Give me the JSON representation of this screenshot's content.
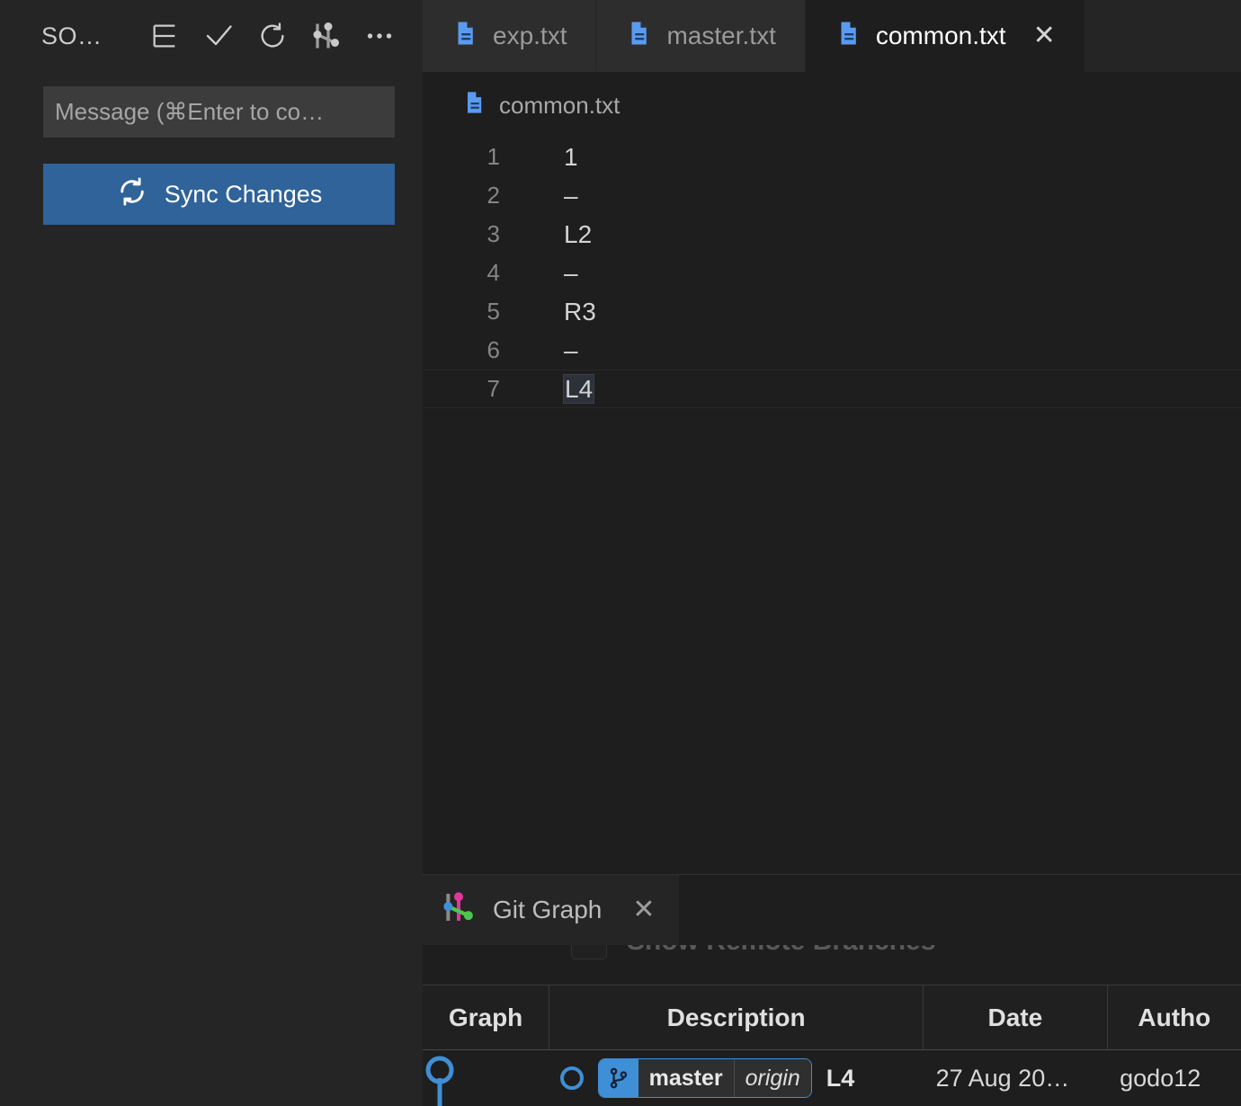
{
  "colors": {
    "accent_blue": "#3f8fd6",
    "button_blue": "#2f6399",
    "editor_bg": "#1e1e1e",
    "sidebar_bg": "#252526",
    "tab_inactive_bg": "#2d2d2d"
  },
  "sidebar": {
    "toolbar": {
      "title": "SO…",
      "buttons": [
        {
          "name": "view-as-tree-icon",
          "label": "View as Tree"
        },
        {
          "name": "commit-check-icon",
          "label": "Commit"
        },
        {
          "name": "refresh-icon",
          "label": "Refresh"
        },
        {
          "name": "git-graph-icon",
          "label": "View Git Graph"
        },
        {
          "name": "more-actions-icon",
          "label": "…"
        }
      ]
    },
    "commit_input": {
      "placeholder": "Message (⌘Enter to co…",
      "value": ""
    },
    "sync_button": {
      "label": "Sync Changes",
      "icon": "sync-icon"
    }
  },
  "editor": {
    "tabs": [
      {
        "label": "exp.txt",
        "icon": "text-file-icon",
        "active": false,
        "closable": false
      },
      {
        "label": "master.txt",
        "icon": "text-file-icon",
        "active": false,
        "closable": false
      },
      {
        "label": "common.txt",
        "icon": "text-file-icon",
        "active": true,
        "closable": true,
        "close_glyph": "✕"
      }
    ],
    "breadcrumb": {
      "icon": "text-file-icon",
      "label": "common.txt"
    },
    "lines": [
      {
        "number": "1",
        "text": "1",
        "current": false
      },
      {
        "number": "2",
        "text": "–",
        "current": false
      },
      {
        "number": "3",
        "text": "L2",
        "current": false
      },
      {
        "number": "4",
        "text": "–",
        "current": false
      },
      {
        "number": "5",
        "text": "R3",
        "current": false
      },
      {
        "number": "6",
        "text": "–",
        "current": false
      },
      {
        "number": "7",
        "text": "L4",
        "current": true
      }
    ]
  },
  "panel": {
    "tab": {
      "label": "Git Graph",
      "icon": "git-graph-color-icon",
      "close_glyph": "✕"
    },
    "show_remote_branches": {
      "label": "Show Remote Branches",
      "checked": false
    },
    "table": {
      "columns": [
        "Graph",
        "Description",
        "Date",
        "Autho"
      ],
      "rows": [
        {
          "graph": "commit-node",
          "branch": "master",
          "remote": "origin",
          "message": "L4",
          "date": "27 Aug 20…",
          "author": "godo12"
        }
      ]
    }
  }
}
